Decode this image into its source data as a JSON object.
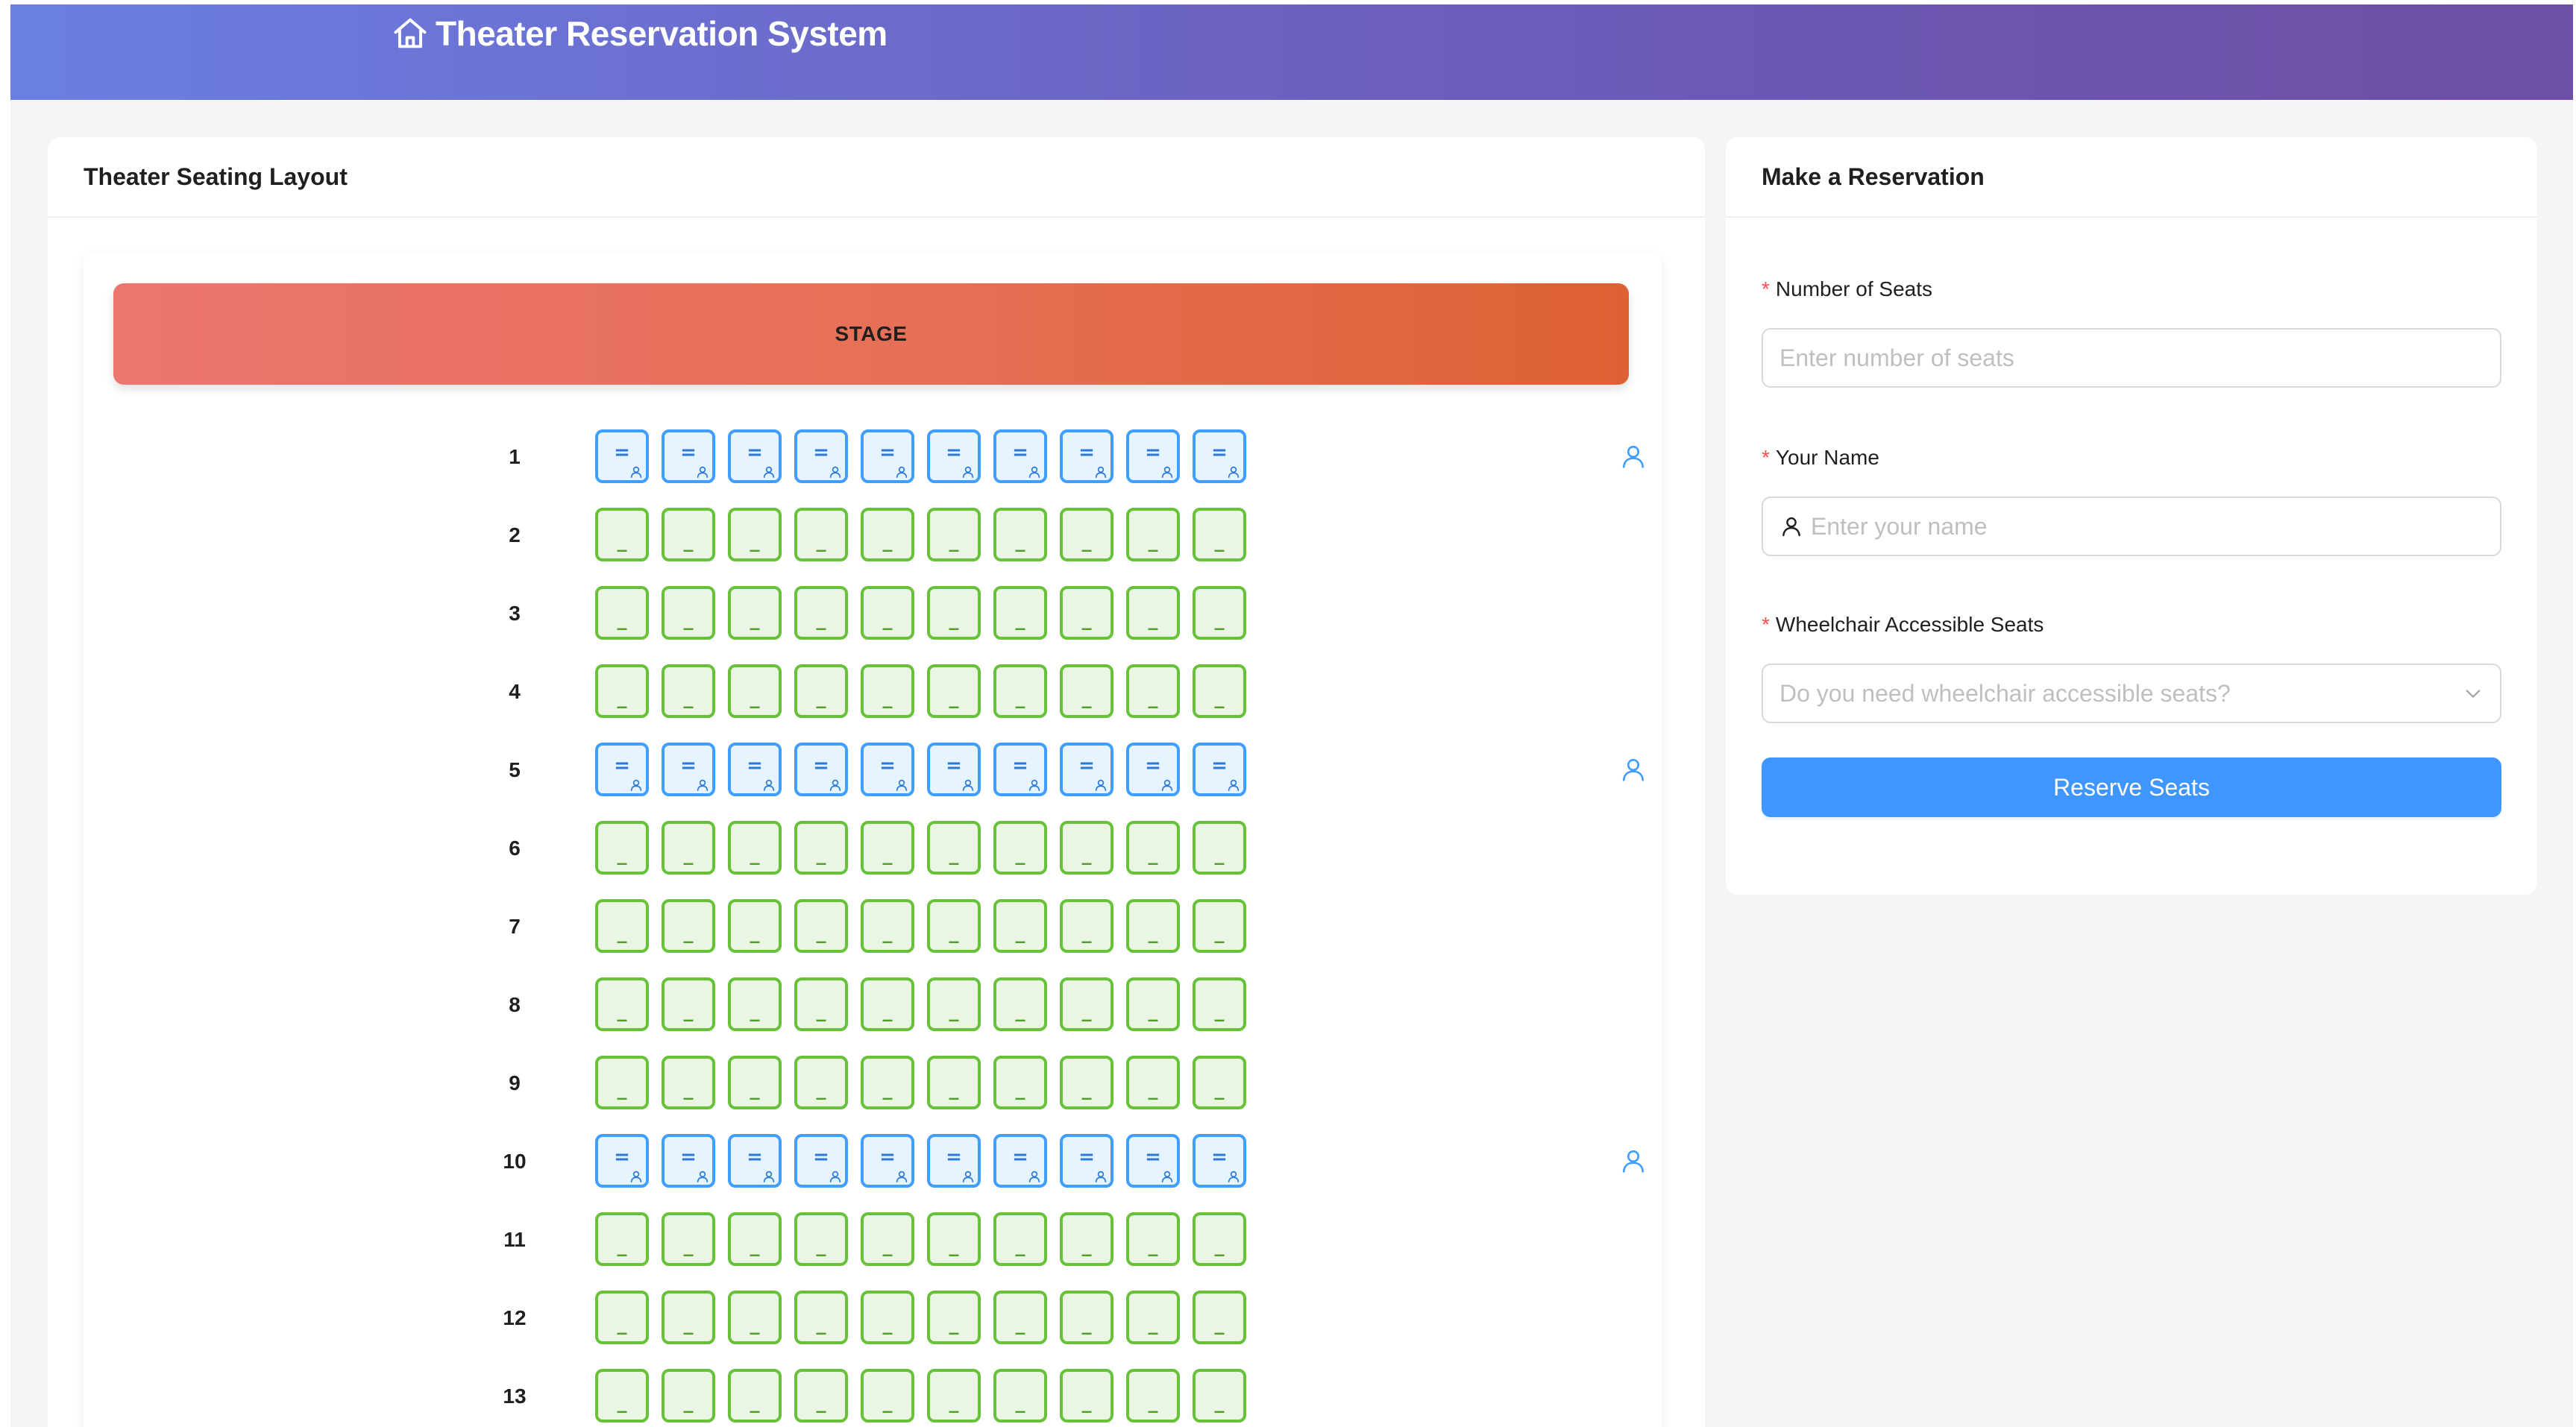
{
  "header": {
    "title": "Theater Reservation System",
    "icon": "home-icon"
  },
  "seating": {
    "card_title": "Theater Seating Layout",
    "stage_label": "STAGE",
    "seats_per_row": 10,
    "available_glyph": "_",
    "accessible_glyph": "=",
    "rows": [
      {
        "label": "1",
        "type": "accessible"
      },
      {
        "label": "2",
        "type": "available"
      },
      {
        "label": "3",
        "type": "available"
      },
      {
        "label": "4",
        "type": "available"
      },
      {
        "label": "5",
        "type": "accessible"
      },
      {
        "label": "6",
        "type": "available"
      },
      {
        "label": "7",
        "type": "available"
      },
      {
        "label": "8",
        "type": "available"
      },
      {
        "label": "9",
        "type": "available"
      },
      {
        "label": "10",
        "type": "accessible"
      },
      {
        "label": "11",
        "type": "available"
      },
      {
        "label": "12",
        "type": "available"
      },
      {
        "label": "13",
        "type": "available"
      }
    ],
    "colors": {
      "available_border": "#67c23a",
      "available_fill": "#eaf5e3",
      "accessible_border": "#409eff",
      "accessible_fill": "#e6f4ff"
    }
  },
  "reservation": {
    "card_title": "Make a Reservation",
    "required_mark": "*",
    "seats_label": "Number of Seats",
    "seats_placeholder": "Enter number of seats",
    "name_label": "Your Name",
    "name_placeholder": "Enter your name",
    "wheelchair_label": "Wheelchair Accessible Seats",
    "wheelchair_placeholder": "Do you need wheelchair accessible seats?",
    "button_label": "Reserve Seats",
    "button_color": "#4096ff"
  }
}
